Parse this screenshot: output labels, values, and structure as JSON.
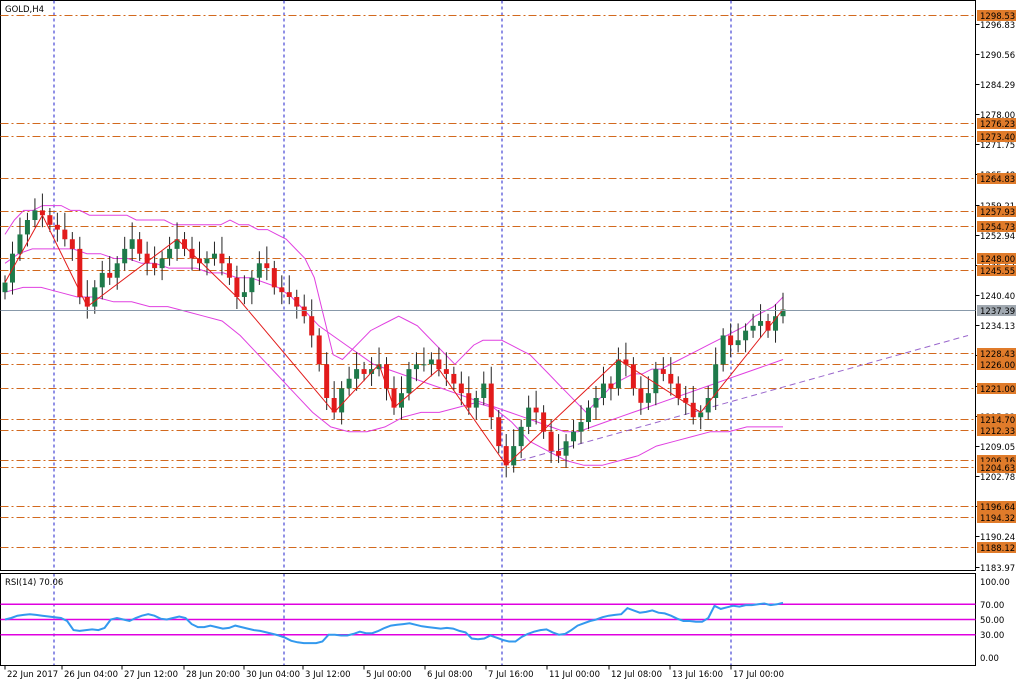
{
  "symbol": "GOLD,H4",
  "colors": {
    "background": "#ffffff",
    "frame": "#000000",
    "level_line": "#d2691e",
    "level_tag": "#e07b2a",
    "grid_vertical": "#2222cc",
    "bull_candle": "#1e7a4a",
    "bear_candle": "#e21b1b",
    "bollinger": "#e040e0",
    "zigzag": "#e21b1b",
    "trend_line": "#9966cc",
    "current_price_line": "#8899aa",
    "current_price_tag": "#a0a8b0",
    "rsi_line": "#3399ee",
    "rsi_levels": "#e000e0",
    "fractal": "#a0a0a0"
  },
  "main_axis": {
    "ticks": [
      "1296.83",
      "1290.56",
      "1284.29",
      "1278.00",
      "1271.75",
      "1265.48",
      "1259.21",
      "1252.94",
      "1246.67",
      "1240.40",
      "1234.13",
      "1227.86",
      "1221.59",
      "1215.32",
      "1209.05",
      "1202.78",
      "1196.51",
      "1190.24",
      "1183.97"
    ]
  },
  "levels": [
    {
      "label": "1298.53",
      "value": 1298.53
    },
    {
      "label": "1276.23",
      "value": 1276.23
    },
    {
      "label": "1273.40",
      "value": 1273.4
    },
    {
      "label": "1264.83",
      "value": 1264.83
    },
    {
      "label": "1257.93",
      "value": 1257.93
    },
    {
      "label": "1254.73",
      "value": 1254.73
    },
    {
      "label": "1248.00",
      "value": 1248.0
    },
    {
      "label": "1245.55",
      "value": 1245.55
    },
    {
      "label": "1228.43",
      "value": 1228.43
    },
    {
      "label": "1226.00",
      "value": 1226.0
    },
    {
      "label": "1221.00",
      "value": 1221.0
    },
    {
      "label": "1214.70",
      "value": 1214.7
    },
    {
      "label": "1212.33",
      "value": 1212.33
    },
    {
      "label": "1206.16",
      "value": 1206.16
    },
    {
      "label": "1204.63",
      "value": 1204.63
    },
    {
      "label": "1196.64",
      "value": 1196.64
    },
    {
      "label": "1194.32",
      "value": 1194.32
    },
    {
      "label": "1188.12",
      "value": 1188.12
    }
  ],
  "current_price": {
    "label": "1237.39",
    "value": 1237.39
  },
  "rsi": {
    "title": "RSI(14) 70.06",
    "ticks": [
      "100.00",
      "70.00",
      "50.00",
      "30.00",
      "0.00"
    ],
    "levels": [
      70,
      50,
      30
    ],
    "values": [
      50,
      52,
      55,
      56,
      57,
      56,
      55,
      54,
      53,
      52,
      48,
      36,
      35,
      36,
      37,
      36,
      39,
      50,
      52,
      50,
      48,
      52,
      55,
      57,
      55,
      51,
      50,
      52,
      54,
      52,
      44,
      40,
      40,
      42,
      40,
      38,
      39,
      42,
      40,
      38,
      36,
      35,
      33,
      31,
      29,
      26,
      22,
      20,
      19,
      19,
      19,
      21,
      30,
      30,
      29,
      29,
      31,
      34,
      32,
      32,
      35,
      39,
      42,
      43,
      44,
      45,
      43,
      41,
      40,
      39,
      38,
      39,
      38,
      35,
      33,
      25,
      24,
      25,
      29,
      26,
      23,
      21,
      21,
      27,
      31,
      34,
      36,
      37,
      33,
      30,
      31,
      36,
      42,
      45,
      48,
      50,
      53,
      55,
      56,
      57,
      65,
      62,
      59,
      60,
      62,
      59,
      58,
      55,
      51,
      48,
      48,
      47,
      47,
      52,
      68,
      64,
      66,
      68,
      67,
      69,
      69,
      70,
      71,
      69,
      70,
      72
    ]
  },
  "x_axis": {
    "labels": [
      "22 Jun 2017",
      "26 Jun 04:00",
      "27 Jun 12:00",
      "28 Jun 20:00",
      "30 Jun 04:00",
      "3 Jul 12:00",
      "5 Jul 00:00",
      "6 Jul 08:00",
      "7 Jul 16:00",
      "11 Jul 00:00",
      "12 Jul 08:00",
      "13 Jul 16:00",
      "17 Jul 00:00"
    ]
  },
  "chart_data": {
    "type": "candlestick",
    "symbol": "GOLD",
    "timeframe": "H4",
    "ylim": [
      1183.97,
      1300.8
    ],
    "closes": [
      1243,
      1249,
      1253,
      1256,
      1258,
      1257,
      1255,
      1254,
      1252,
      1250,
      1240,
      1238,
      1242,
      1245,
      1244,
      1247,
      1250,
      1252,
      1249,
      1247,
      1246,
      1248,
      1250,
      1252,
      1250,
      1248,
      1247,
      1248,
      1249,
      1247,
      1244,
      1240,
      1241,
      1244,
      1247,
      1246,
      1242,
      1241,
      1240,
      1238,
      1236,
      1232,
      1226,
      1219,
      1216,
      1221,
      1223,
      1225,
      1224,
      1225,
      1226,
      1221,
      1217,
      1220,
      1225,
      1226,
      1226,
      1227,
      1225,
      1224,
      1222,
      1220,
      1217,
      1219,
      1222,
      1215,
      1209,
      1205,
      1209,
      1213,
      1217,
      1216,
      1212,
      1208,
      1207,
      1210,
      1212,
      1214,
      1217,
      1219,
      1222,
      1221,
      1227,
      1226,
      1221,
      1218,
      1220,
      1225,
      1224,
      1222,
      1219,
      1218,
      1215,
      1216,
      1219,
      1226,
      1232,
      1230,
      1231,
      1233,
      1234,
      1235,
      1233,
      1236,
      1237.39
    ],
    "series": [
      {
        "name": "Bollinger Upper",
        "values": [
          1253,
          1256,
          1258,
          1258,
          1259,
          1259,
          1259,
          1258,
          1258,
          1257,
          1257,
          1257,
          1257,
          1257,
          1256,
          1256,
          1256,
          1256,
          1255,
          1255,
          1255,
          1255,
          1255,
          1255,
          1256,
          1255,
          1255,
          1254,
          1254,
          1253,
          1252,
          1250,
          1248,
          1244,
          1236,
          1228,
          1227,
          1229,
          1231,
          1233,
          1234,
          1235,
          1236,
          1235,
          1234,
          1232,
          1230,
          1228,
          1226,
          1228,
          1230,
          1231,
          1231,
          1231,
          1230,
          1229,
          1228,
          1226,
          1224,
          1222,
          1220,
          1218,
          1216,
          1218,
          1220,
          1222,
          1223,
          1224,
          1224,
          1225,
          1225,
          1226,
          1227,
          1228,
          1229,
          1230,
          1231,
          1232,
          1233,
          1234,
          1236,
          1237,
          1238,
          1240
        ]
      },
      {
        "name": "Bollinger Middle",
        "values": [
          1247,
          1249,
          1250,
          1250,
          1250,
          1250,
          1249,
          1249,
          1248,
          1248,
          1247,
          1247,
          1246,
          1246,
          1246,
          1245,
          1245,
          1244,
          1244,
          1243,
          1242,
          1240,
          1237,
          1234,
          1232,
          1230,
          1228,
          1226,
          1225,
          1224,
          1223,
          1222,
          1221,
          1220,
          1219,
          1218,
          1217,
          1216,
          1215,
          1214,
          1213,
          1212,
          1212,
          1213,
          1214,
          1215,
          1216,
          1217,
          1218,
          1219,
          1220,
          1221,
          1222,
          1223,
          1224,
          1225,
          1226,
          1227
        ]
      },
      {
        "name": "Bollinger Lower",
        "values": [
          1241,
          1242,
          1242,
          1241,
          1240,
          1240,
          1239,
          1239,
          1238,
          1238,
          1237,
          1236,
          1235,
          1232,
          1228,
          1224,
          1220,
          1216,
          1213,
          1212,
          1212,
          1213,
          1215,
          1216,
          1216,
          1217,
          1218,
          1217,
          1214,
          1210,
          1208,
          1206,
          1205,
          1205,
          1206,
          1207,
          1209,
          1210,
          1211,
          1212,
          1212,
          1213,
          1213,
          1213
        ]
      }
    ]
  }
}
